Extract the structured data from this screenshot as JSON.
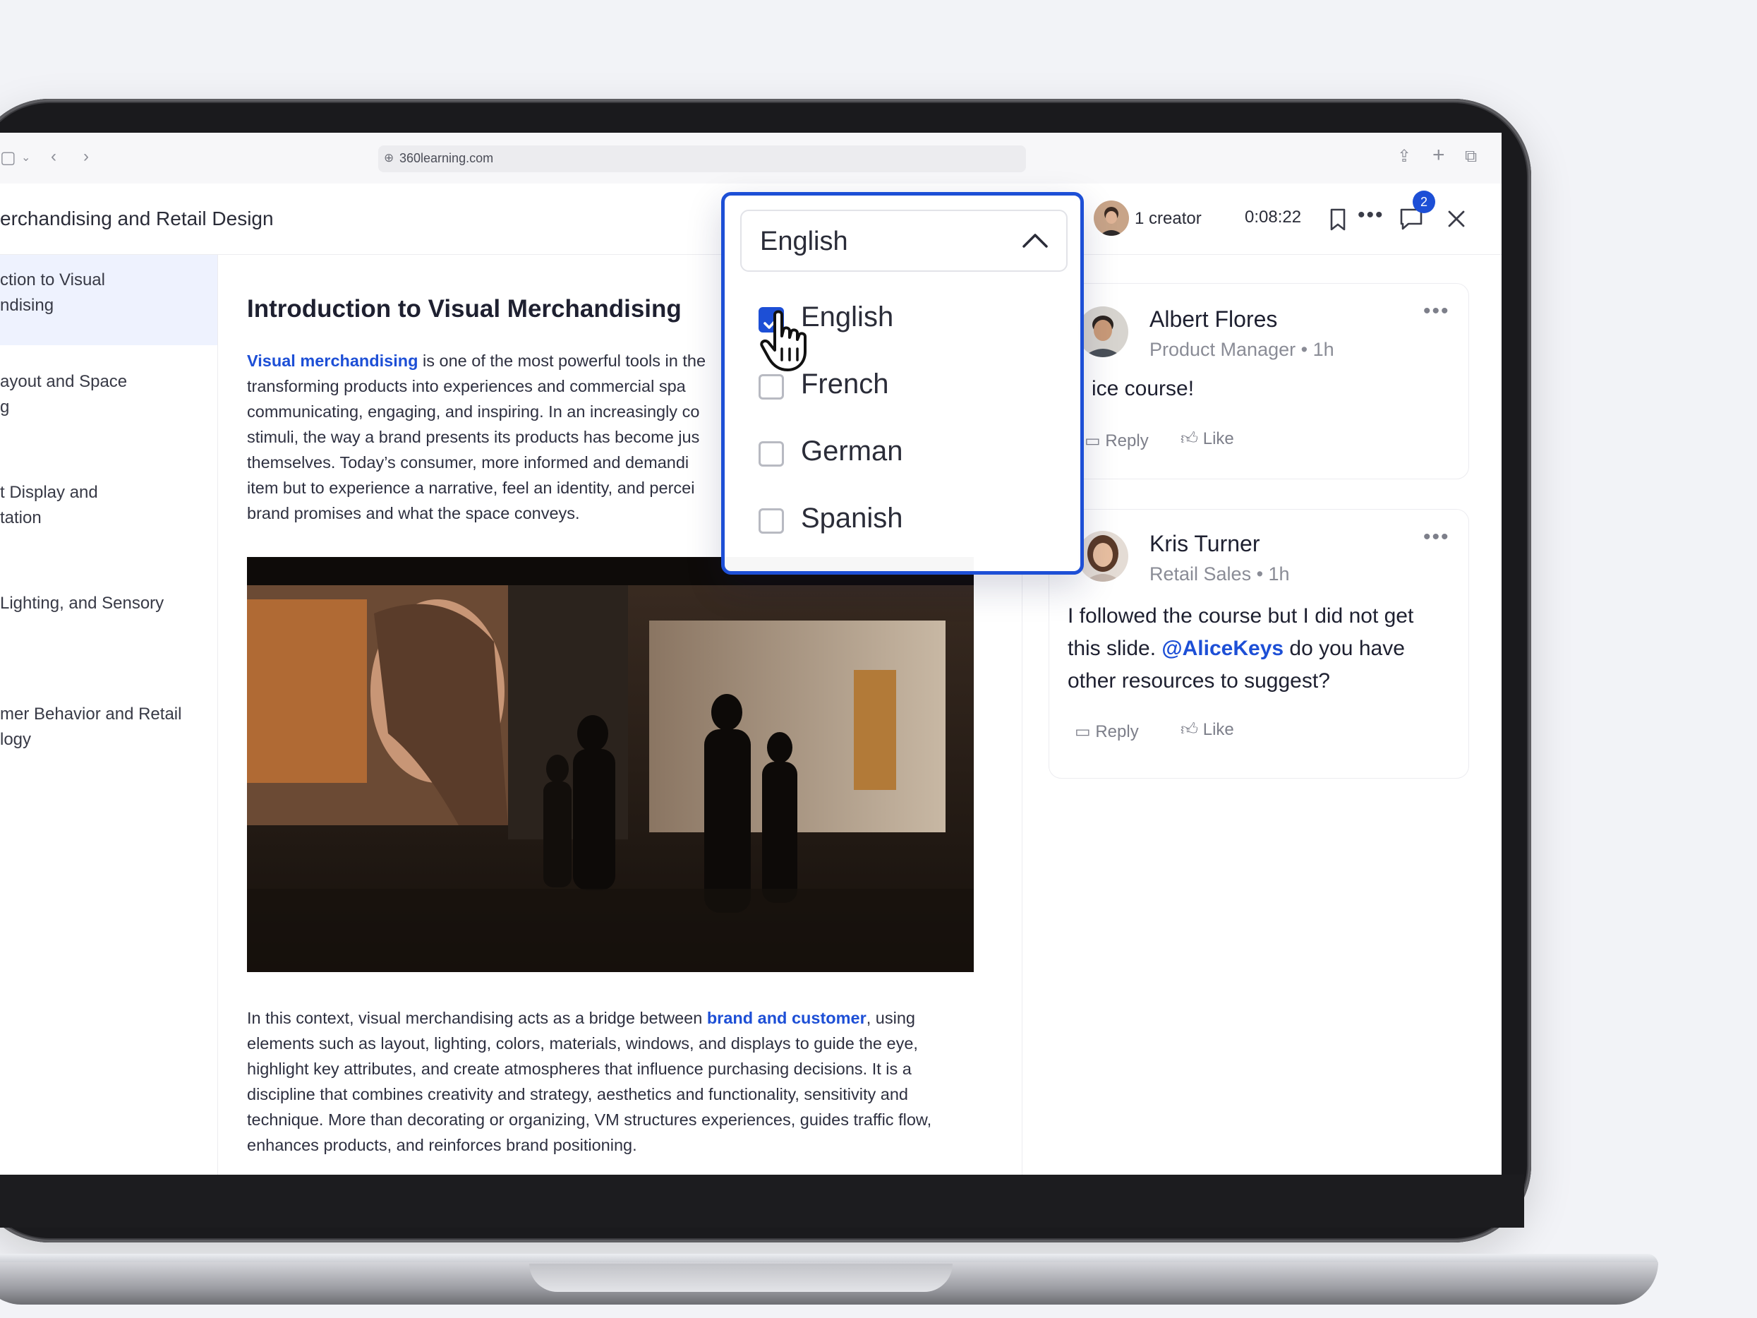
{
  "browser": {
    "url": "360learning.com"
  },
  "header": {
    "course_title": "erchandising and Retail Design",
    "creator_label": "1 creator",
    "timer": "0:08:22",
    "comments_badge": "2"
  },
  "sidebar": {
    "items": [
      {
        "line1": "ction to Visual",
        "line2": "ndising",
        "active": true
      },
      {
        "line1": "ayout and Space",
        "line2": "g",
        "active": false
      },
      {
        "line1": "t Display and",
        "line2": "tation",
        "active": false
      },
      {
        "line1": "Lighting, and Sensory",
        "line2": "",
        "active": false
      },
      {
        "line1": "mer Behavior and Retail",
        "line2": "logy",
        "active": false
      }
    ]
  },
  "main": {
    "heading": "Introduction to Visual Merchandising",
    "para1": {
      "link": "Visual merchandising",
      "lines": [
        " is one of the most powerful tools in the",
        "transforming products into experiences and commercial spa",
        "communicating, engaging, and inspiring. In an increasingly co",
        "stimuli, the way a brand presents its products has become jus",
        "themselves. Today’s consumer, more informed and demandi",
        "item but to experience a narrative, feel an identity, and percei",
        "brand promises and what the space conveys."
      ]
    },
    "para2": {
      "before_link": "In this context, visual merchandising acts as a bridge between ",
      "link": "brand and customer",
      "after_link": ", using",
      "lines": [
        "elements such as layout, lighting, colors, materials, windows, and displays to guide the eye,",
        "highlight key attributes, and create atmospheres that influence purchasing decisions. It is a",
        "discipline that combines creativity and strategy, aesthetics and functionality, sensitivity and",
        "technique. More than decorating or organizing, VM structures experiences, guides traffic flow,",
        "enhances products, and reinforces brand positioning."
      ]
    }
  },
  "comments": [
    {
      "name": "Albert Flores",
      "role": "Product Manager • 1h",
      "text": "ice course!",
      "reply": "Reply",
      "like": "Like"
    },
    {
      "name": "Kris Turner",
      "role": "Retail Sales • 1h",
      "text_line1": "I followed the course but I did not get",
      "text_line2_before": "this slide. ",
      "mention": "@AliceKeys",
      "text_line2_after": " do you have",
      "text_line3": "other resources to suggest?",
      "reply": "Reply",
      "like": "Like"
    }
  ],
  "language_dropdown": {
    "selected": "English",
    "options": [
      {
        "label": "English",
        "checked": true
      },
      {
        "label": "French",
        "checked": false
      },
      {
        "label": "German",
        "checked": false
      },
      {
        "label": "Spanish",
        "checked": false
      }
    ]
  },
  "colors": {
    "accent": "#1d4fd6",
    "background": "#f2f3f7"
  }
}
